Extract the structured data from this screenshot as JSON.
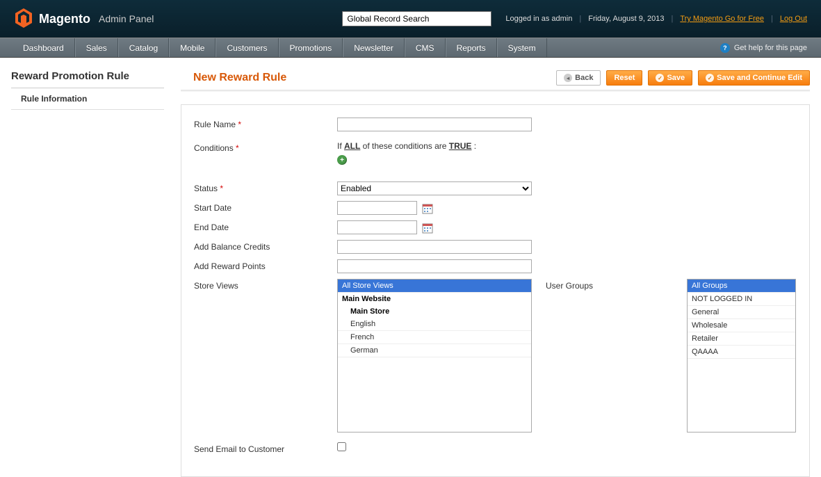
{
  "header": {
    "logo_main": "Magento",
    "logo_sub": "Admin Panel",
    "search_placeholder": "Global Record Search",
    "logged_in": "Logged in as admin",
    "date": "Friday, August 9, 2013",
    "try_link": "Try Magento Go for Free",
    "logout": "Log Out"
  },
  "nav": {
    "items": [
      "Dashboard",
      "Sales",
      "Catalog",
      "Mobile",
      "Customers",
      "Promotions",
      "Newsletter",
      "CMS",
      "Reports",
      "System"
    ],
    "help": "Get help for this page"
  },
  "sidebar": {
    "title": "Reward Promotion Rule",
    "item": "Rule Information"
  },
  "page": {
    "title": "New Reward Rule",
    "btn_back": "Back",
    "btn_reset": "Reset",
    "btn_save": "Save",
    "btn_save_continue": "Save and Continue Edit"
  },
  "form": {
    "rule_name": "Rule Name",
    "conditions": "Conditions",
    "conditions_if": "If ",
    "conditions_all": "ALL",
    "conditions_of": "  of these conditions are ",
    "conditions_true": "TRUE",
    "conditions_colon": " :",
    "status": "Status",
    "status_value": "Enabled",
    "start_date": "Start Date",
    "end_date": "End Date",
    "balance_credits": "Add Balance Credits",
    "reward_points": "Add Reward Points",
    "store_views": "Store Views",
    "user_groups": "User Groups",
    "send_email": "Send Email to Customer",
    "sv_all": "All Store Views",
    "sv_main_website": "Main Website",
    "sv_main_store": "Main Store",
    "sv_english": "English",
    "sv_french": "French",
    "sv_german": "German",
    "ug_all": "All Groups",
    "ug_notlogged": "NOT LOGGED IN",
    "ug_general": "General",
    "ug_wholesale": "Wholesale",
    "ug_retailer": "Retailer",
    "ug_qaaaa": "QAAAA"
  }
}
